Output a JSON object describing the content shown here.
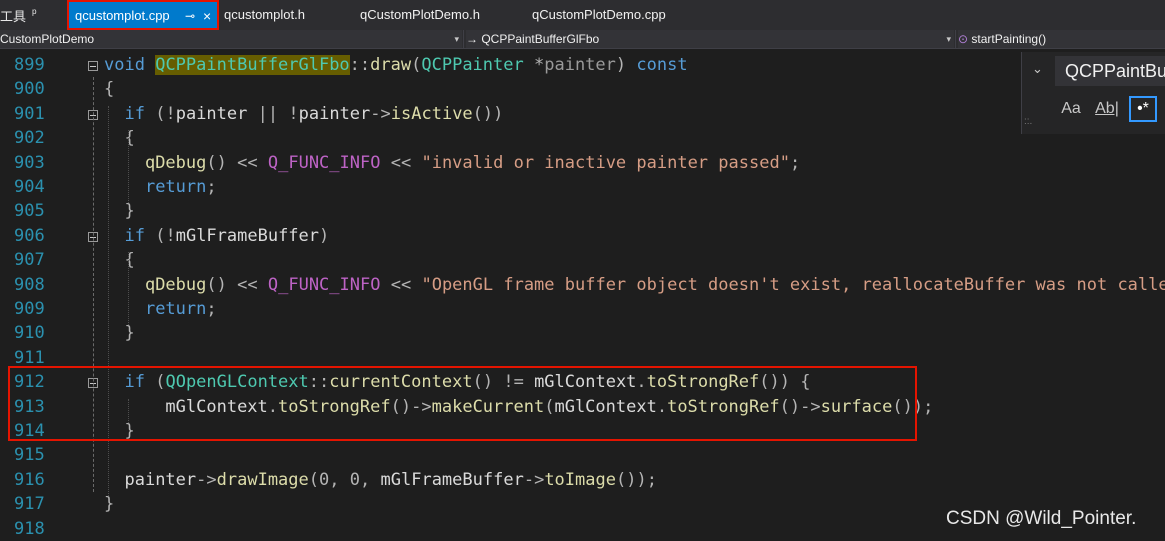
{
  "toolbar": {
    "menu_label": "工具",
    "pin_glyph": "ₚ"
  },
  "tabs": [
    {
      "label": "qcustomplot.cpp",
      "active": true,
      "pin": "⊸",
      "close": "×"
    },
    {
      "label": "qcustomplot.h"
    },
    {
      "label": "qCustomPlotDemo.h"
    },
    {
      "label": "qCustomPlotDemo.cpp"
    }
  ],
  "navbar": {
    "project": "CustomPlotDemo",
    "scope_prefix": "→",
    "scope": "QCPPaintBufferGlFbo",
    "member_icon": "⊙",
    "member": "startPainting()",
    "caret": "▾"
  },
  "find": {
    "chevron": "⌄",
    "query": "QCPPaintBu",
    "match_case": "Aa",
    "match_word": "Ab|",
    "regex": "•*",
    "grip": "::."
  },
  "editor": {
    "line_numbers": [
      "899",
      "900",
      "901",
      "902",
      "903",
      "904",
      "905",
      "906",
      "907",
      "908",
      "909",
      "910",
      "911",
      "912",
      "913",
      "914",
      "915",
      "916",
      "917",
      "918"
    ],
    "lines": [
      {
        "t": "void QCPPaintBufferGlFbo::draw(QCPPainter *painter) const"
      },
      {
        "t": "{"
      },
      {
        "t": "  if (!painter || !painter->isActive())"
      },
      {
        "t": "  {"
      },
      {
        "t": "    qDebug() << Q_FUNC_INFO << \"invalid or inactive painter passed\";"
      },
      {
        "t": "    return;"
      },
      {
        "t": "  }"
      },
      {
        "t": "  if (!mGlFrameBuffer)"
      },
      {
        "t": "  {"
      },
      {
        "t": "    qDebug() << Q_FUNC_INFO << \"OpenGL frame buffer object doesn't exist, reallocateBuffer was not called?\";"
      },
      {
        "t": "    return;"
      },
      {
        "t": "  }"
      },
      {
        "t": ""
      },
      {
        "t": "  if (QOpenGLContext::currentContext() != mGlContext.toStrongRef()) {"
      },
      {
        "t": "      mGlContext.toStrongRef()->makeCurrent(mGlContext.toStrongRef()->surface());"
      },
      {
        "t": "  }"
      },
      {
        "t": ""
      },
      {
        "t": "  painter->drawImage(0, 0, mGlFrameBuffer->toImage());"
      },
      {
        "t": "}"
      },
      {
        "t": ""
      }
    ]
  },
  "watermark": "CSDN @Wild_Pointer."
}
